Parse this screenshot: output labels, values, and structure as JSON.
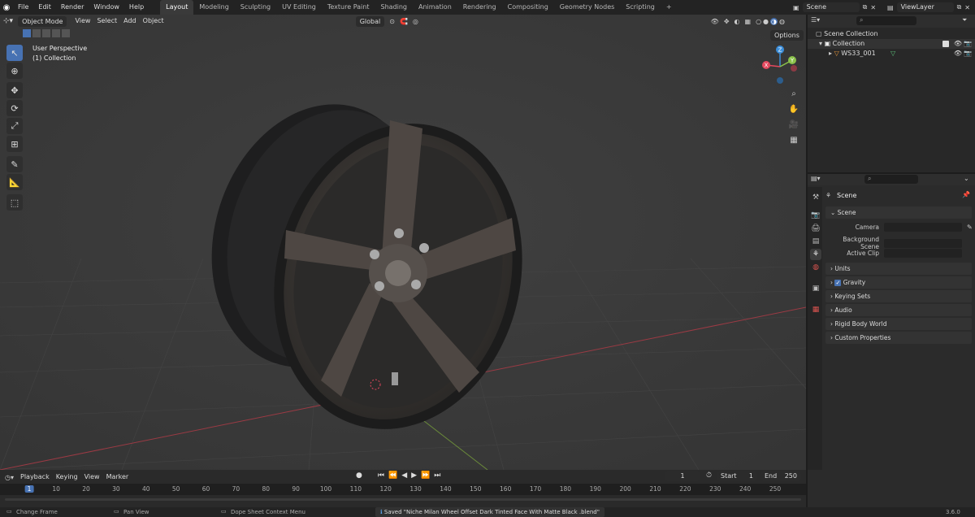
{
  "topbar": {
    "menus": [
      "File",
      "Edit",
      "Render",
      "Window",
      "Help"
    ],
    "workspaces": [
      "Layout",
      "Modeling",
      "Sculpting",
      "UV Editing",
      "Texture Paint",
      "Shading",
      "Animation",
      "Rendering",
      "Compositing",
      "Geometry Nodes",
      "Scripting"
    ],
    "active_workspace": "Layout",
    "add_tab": "+",
    "scene_name": "Scene",
    "view_layer": "ViewLayer"
  },
  "viewport": {
    "mode": "Object Mode",
    "menus": [
      "View",
      "Select",
      "Add",
      "Object"
    ],
    "transform_orientation": "Global",
    "options_label": "Options",
    "overlay_title": "User Perspective",
    "overlay_subtitle": "(1) Collection",
    "gizmo": {
      "x": "X",
      "y": "Y",
      "z": "Z"
    }
  },
  "outliner": {
    "root": "Scene Collection",
    "collection": "Collection",
    "object": "WS33_001"
  },
  "properties": {
    "header": "Scene",
    "section": "Scene",
    "fields": [
      {
        "label": "Camera"
      },
      {
        "label": "Background Scene"
      },
      {
        "label": "Active Clip"
      }
    ],
    "panels": [
      "Units",
      "Gravity",
      "Keying Sets",
      "Audio",
      "Rigid Body World",
      "Custom Properties"
    ],
    "gravity_checked": true
  },
  "timeline": {
    "menus": [
      "Playback",
      "Keying",
      "View",
      "Marker"
    ],
    "current_frame": "1",
    "start_label": "Start",
    "start_value": "1",
    "end_label": "End",
    "end_value": "250",
    "ticks": [
      "1",
      "10",
      "20",
      "30",
      "40",
      "50",
      "60",
      "70",
      "80",
      "90",
      "100",
      "110",
      "120",
      "130",
      "140",
      "150",
      "160",
      "170",
      "180",
      "190",
      "200",
      "210",
      "220",
      "230",
      "240",
      "250"
    ]
  },
  "statusbar": {
    "change_frame": "Change Frame",
    "pan_view": "Pan View",
    "context_menu": "Dope Sheet Context Menu",
    "message": "Saved \"Niche Milan Wheel Offset Dark Tinted Face With Matte Black .blend\"",
    "version": "3.6.0"
  },
  "colors": {
    "accent": "#4772b3",
    "axis_x": "#e4485e",
    "axis_y": "#8bc34a",
    "axis_z": "#3c8ed9",
    "object_icon": "#e8973b"
  }
}
